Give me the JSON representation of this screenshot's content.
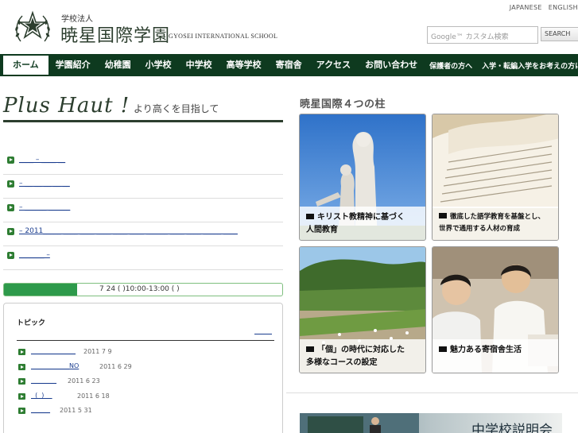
{
  "header": {
    "logo_small": "学校法人",
    "logo_main": "暁星国際学園",
    "logo_en": "GYOSEI INTERNATIONAL SCHOOL",
    "lang_ja": "JAPANESE",
    "lang_en": "ENGLISH",
    "search_placeholder": "Google™ カスタム検索",
    "search_button": "SEARCH"
  },
  "nav": {
    "items": [
      {
        "label": "ホーム"
      },
      {
        "label": "学園紹介"
      },
      {
        "label": "幼稚園"
      },
      {
        "label": "小学校"
      },
      {
        "label": "中学校"
      },
      {
        "label": "高等学校"
      },
      {
        "label": "寄宿舎"
      },
      {
        "label": "アクセス"
      },
      {
        "label": "お問い合わせ"
      }
    ],
    "sub_items": [
      {
        "label": "保護者の方へ"
      },
      {
        "label": "入学・転編入学をお考えの方に"
      }
    ]
  },
  "tagline": {
    "script": "Plus Haut !",
    "jp": "より高くを目指して"
  },
  "news": [
    {
      "text": "____ – ____ __"
    },
    {
      "text": "         – __ __ __ __ __"
    },
    {
      "text": "         – ______ ______"
    },
    {
      "text": "     – 2011_____ ____ ____ ____ ____ ____ ______ ____ ____ _____ ____"
    },
    {
      "text": "_______ –"
    }
  ],
  "event": {
    "text": "7 24 ( )10:00-13:00      (    )"
  },
  "topics": {
    "title": "トピック",
    "items": [
      {
        "link": "______________",
        "date": "2011 7 9"
      },
      {
        "link": "____________NO",
        "date": "2011 6 29"
      },
      {
        "link": "________",
        "date": "2011 6 23"
      },
      {
        "link": "  (  )    ",
        "date": "2011 6 18"
      },
      {
        "link": "______",
        "date": "2011 5 31"
      }
    ]
  },
  "pillars": {
    "title": "暁星国際４つの柱",
    "items": [
      {
        "line1": "キリスト教精神に基づく",
        "line2": "人間教育"
      },
      {
        "line1": "徹底した語学教育を基盤とし、",
        "line2": "世界で通用する人材の育成"
      },
      {
        "line1": "「個」の時代に対応した",
        "line2": "多様なコースの設定"
      },
      {
        "line1": "魅力ある寄宿舎生活",
        "line2": ""
      }
    ]
  },
  "banner": {
    "text": "中学校説明会"
  }
}
